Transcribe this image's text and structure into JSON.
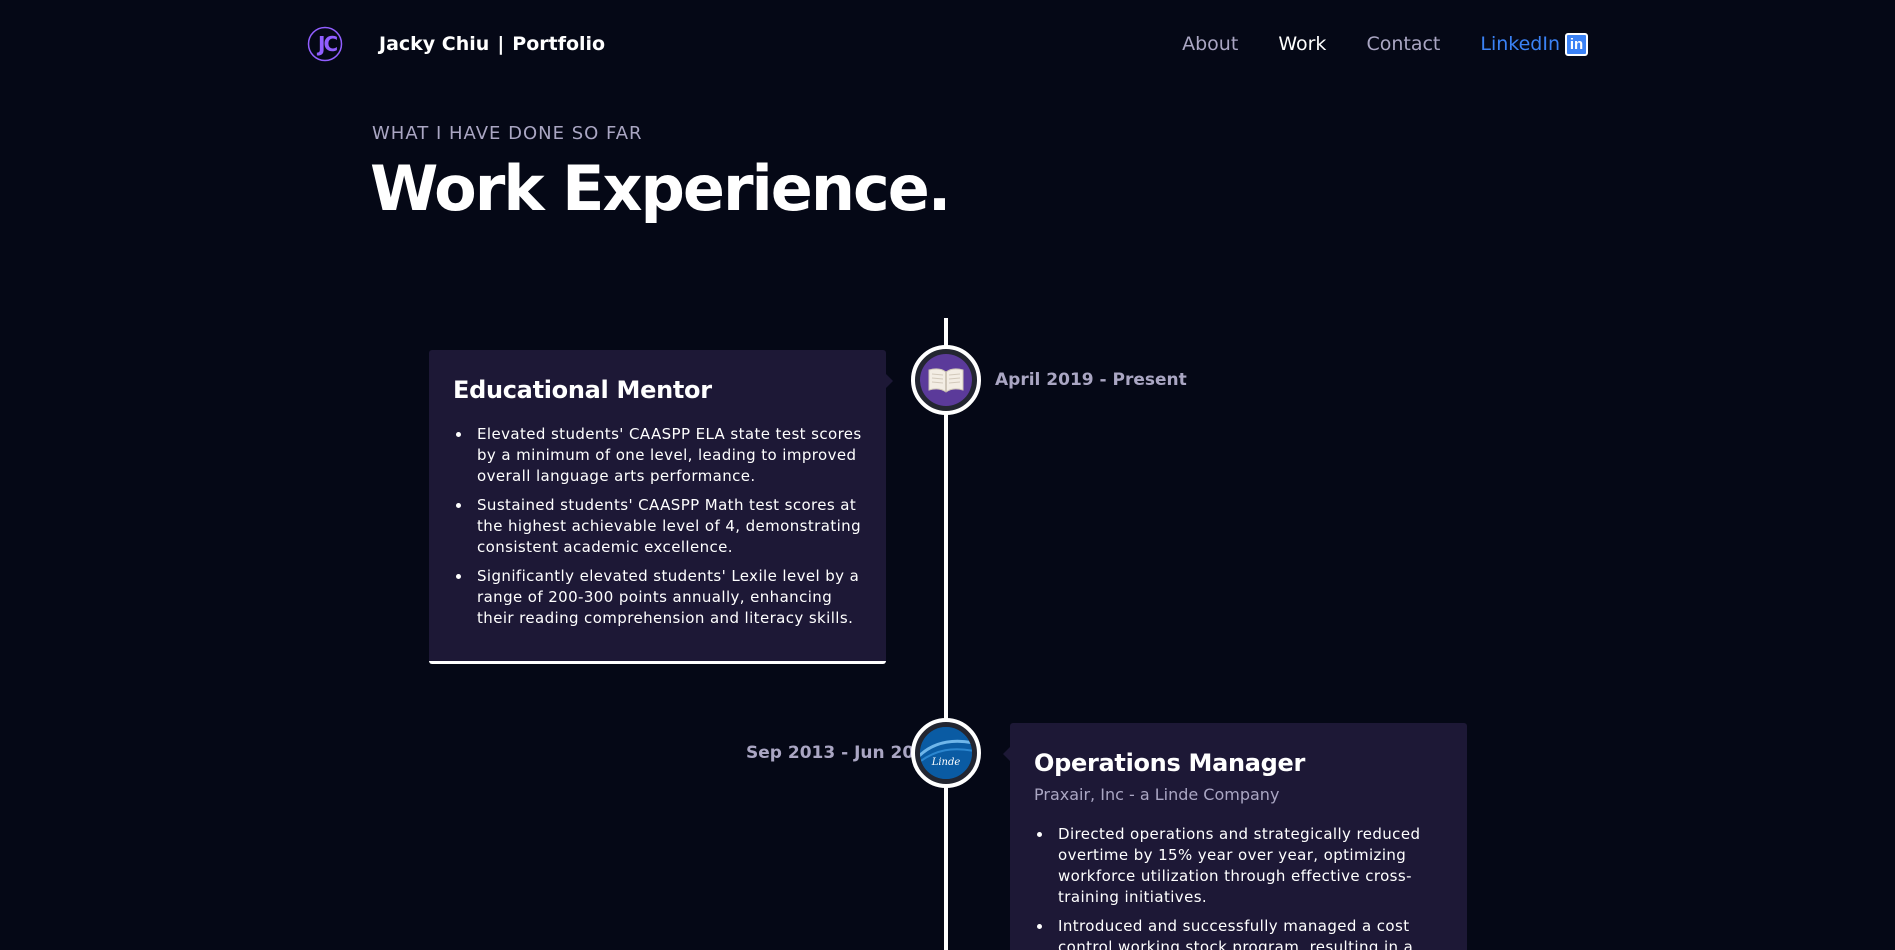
{
  "navbar": {
    "brand_first": "Jacky Chiu",
    "brand_separator": "|",
    "brand_second": "Portfolio",
    "links": [
      {
        "label": "About",
        "active": false
      },
      {
        "label": "Work",
        "active": true
      },
      {
        "label": "Contact",
        "active": false
      },
      {
        "label": "LinkedIn",
        "icon": "linkedin-icon",
        "badge": "in"
      }
    ],
    "logo_icon": "jc-logo-icon"
  },
  "section": {
    "subtitle": "What I have done so far",
    "title": "Work Experience."
  },
  "experiences": [
    {
      "title": "Educational Mentor",
      "date": "April 2019 - Present",
      "icon": "open-book-icon",
      "points": [
        "Elevated students' CAASPP ELA state test scores by a minimum of one level, leading to improved overall language arts performance.",
        "Sustained students' CAASPP Math test scores at the highest achievable level of 4, demonstrating consistent academic excellence.",
        "Significantly elevated students' Lexile level by a range of 200-300 points annually, enhancing their reading comprehension and literacy skills."
      ]
    },
    {
      "title": "Operations Manager",
      "company": "Praxair, Inc - a Linde Company",
      "date": "Sep 2013 - Jun 2017",
      "icon": "linde-logo-icon",
      "icon_text": "Linde",
      "points": [
        "Directed operations and strategically reduced overtime by 15% year over year, optimizing workforce utilization through effective cross-training initiatives.",
        "Introduced and successfully managed a cost control working stock program, resulting in a"
      ]
    }
  ],
  "colors": {
    "background": "#050816",
    "card": "#1d1836",
    "secondary_text": "#aaa6c3",
    "accent_purple": "#915eff",
    "linkedin_blue": "#3b82f6"
  }
}
